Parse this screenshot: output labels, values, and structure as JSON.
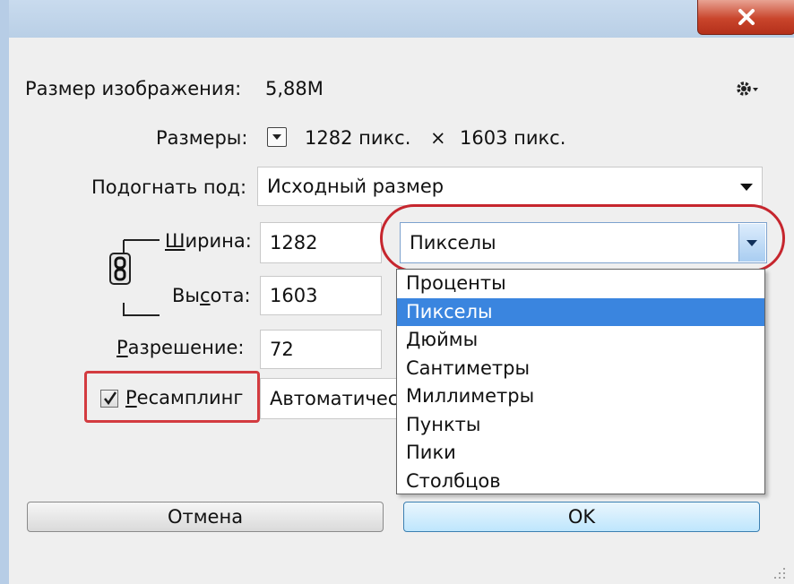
{
  "window": {
    "close_icon": "close-icon"
  },
  "dialog": {
    "image_size_label": "Размер изображения:",
    "image_size_value": "5,88M",
    "dimensions_label": "Размеры:",
    "dimensions_width": "1282 пикс.",
    "dimensions_sep": "×",
    "dimensions_height": "1603 пикс.",
    "fit_label": "Подогнать под:",
    "fit_value": "Исходный размер",
    "width_label": "Ширина:",
    "width_value": "1282",
    "height_label": "Высота:",
    "height_value": "1603",
    "resolution_label": "Разрешение:",
    "resolution_value": "72",
    "resample_label": "Ресамплинг",
    "resample_checked": true,
    "resample_method": "Автоматичес",
    "units_selected": "Пикселы",
    "units_options": [
      "Проценты",
      "Пикселы",
      "Дюймы",
      "Сантиметры",
      "Миллиметры",
      "Пункты",
      "Пики",
      "Столбцов"
    ],
    "cancel_label": "Отмена",
    "ok_label": "OK"
  },
  "colors": {
    "highlight": "#3a85df",
    "annotation_red": "#c6262e"
  }
}
